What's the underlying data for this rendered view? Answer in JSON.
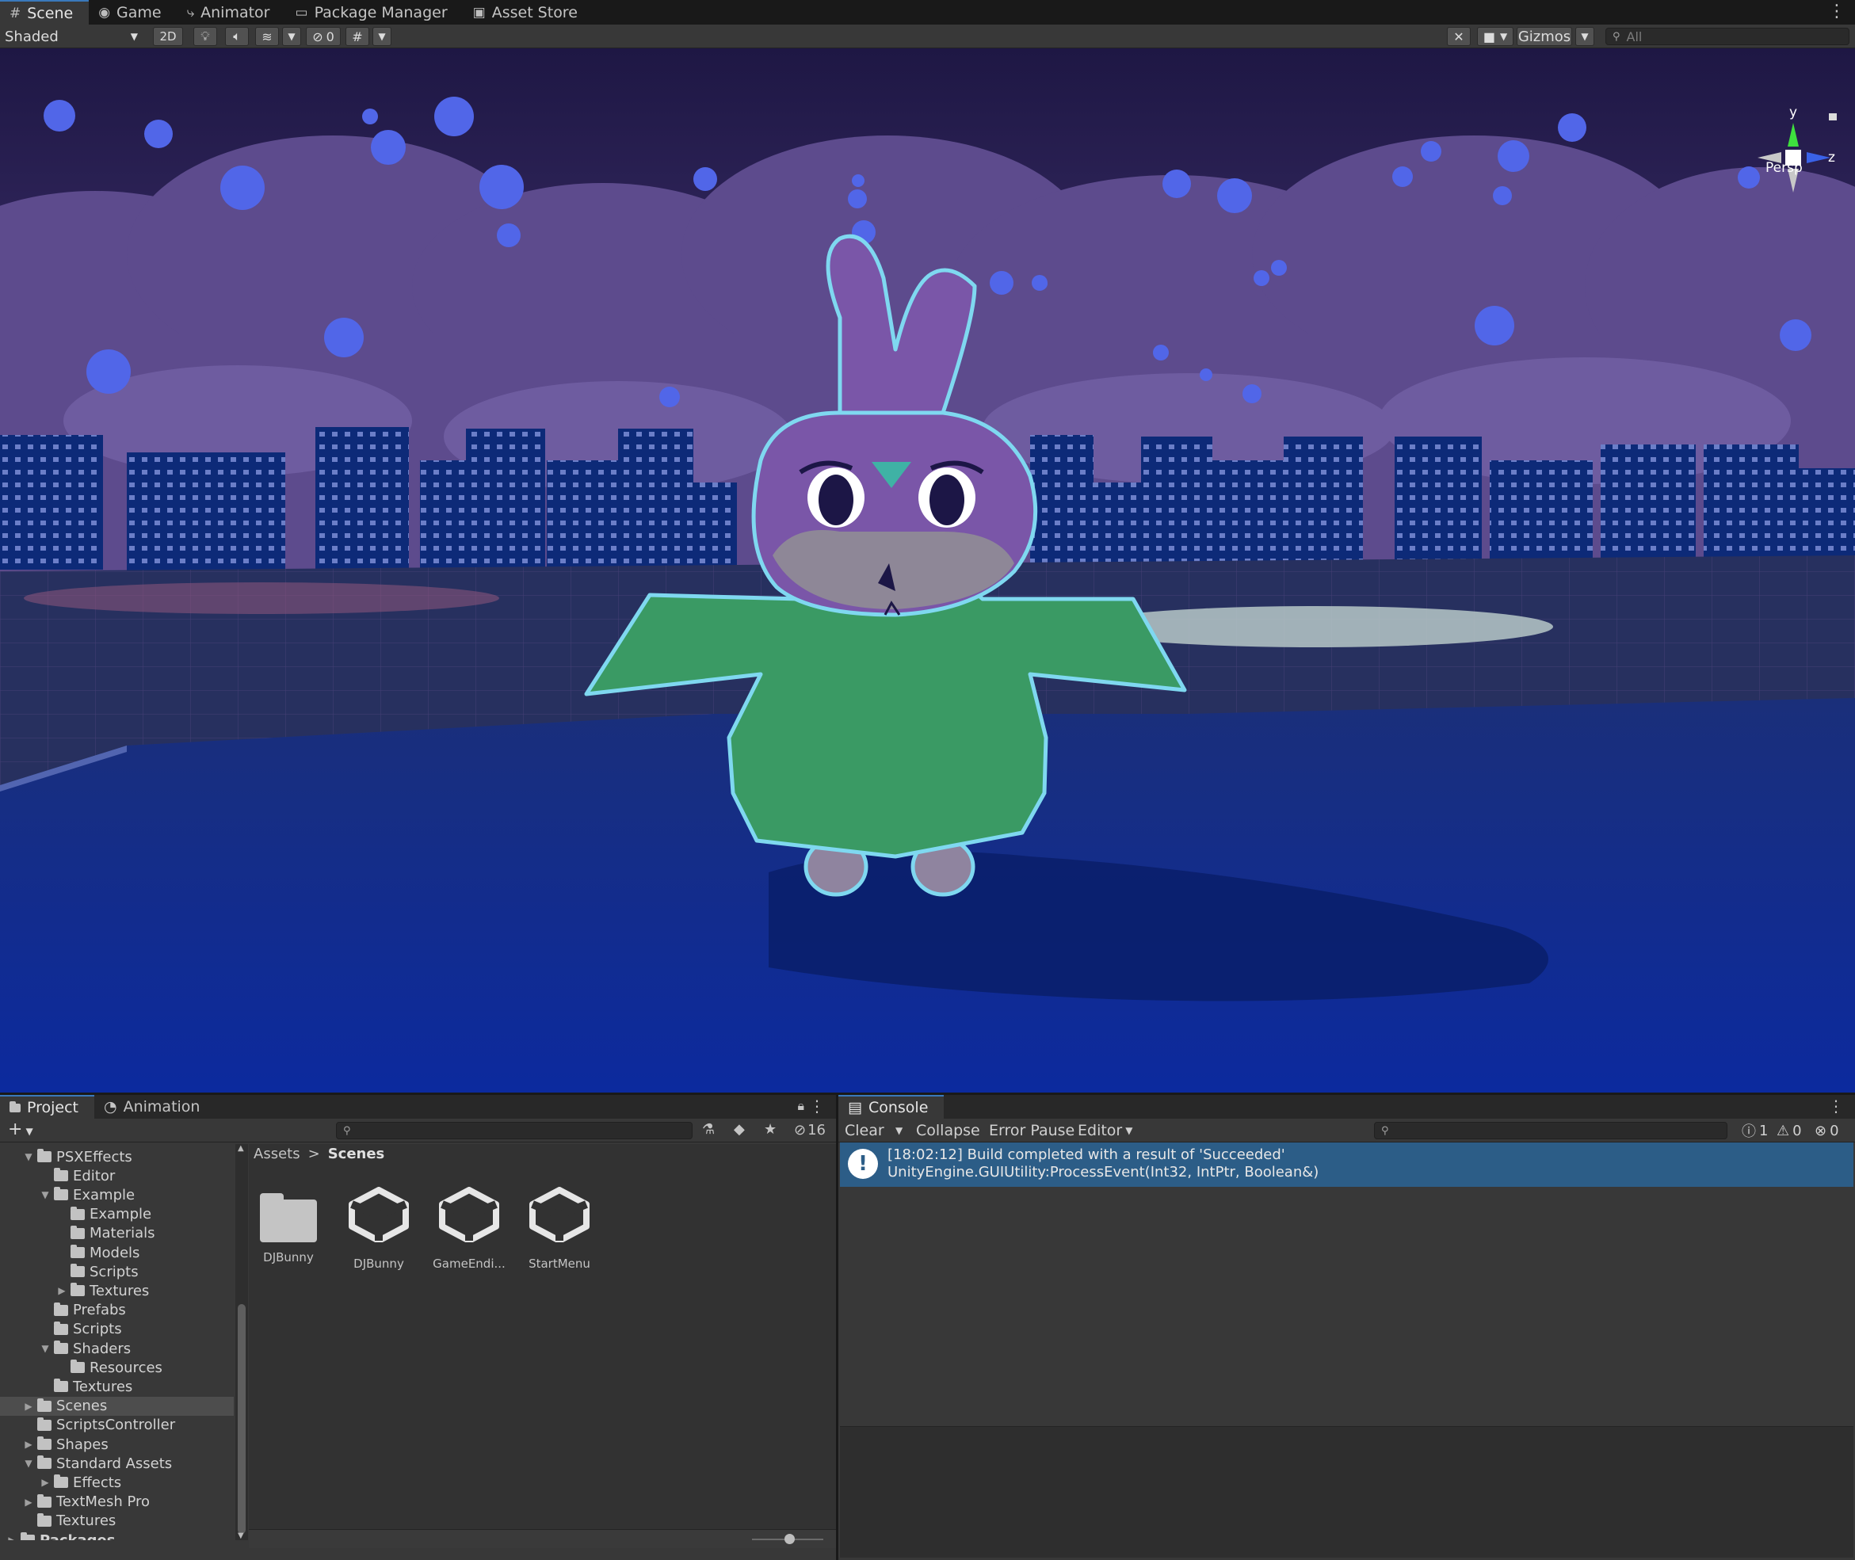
{
  "top_tabs": [
    {
      "label": "Scene",
      "icon": "grid-icon",
      "active": true
    },
    {
      "label": "Game",
      "icon": "gamepad-icon",
      "active": false
    },
    {
      "label": "Animator",
      "icon": "animator-icon",
      "active": false
    },
    {
      "label": "Package Manager",
      "icon": "package-icon",
      "active": false
    },
    {
      "label": "Asset Store",
      "icon": "store-icon",
      "active": false
    }
  ],
  "scene_toolbar": {
    "shading_mode": "Shaded",
    "mode_2d": "2D",
    "hidden_count": "0",
    "gizmos": "Gizmos",
    "search_placeholder": "All"
  },
  "gizmo": {
    "y_label": "y",
    "z_label": "z",
    "projection": "Persp"
  },
  "project_panel": {
    "tabs": [
      {
        "label": "Project",
        "icon": "folder-icon",
        "active": true
      },
      {
        "label": "Animation",
        "icon": "clock-icon",
        "active": false
      }
    ],
    "visible_count": "16",
    "tree": [
      {
        "label": "PSXEffects",
        "depth": 1,
        "arrow": "expanded"
      },
      {
        "label": "Editor",
        "depth": 2,
        "arrow": "none"
      },
      {
        "label": "Example",
        "depth": 2,
        "arrow": "expanded"
      },
      {
        "label": "Example",
        "depth": 3,
        "arrow": "none"
      },
      {
        "label": "Materials",
        "depth": 3,
        "arrow": "none"
      },
      {
        "label": "Models",
        "depth": 3,
        "arrow": "none"
      },
      {
        "label": "Scripts",
        "depth": 3,
        "arrow": "none"
      },
      {
        "label": "Textures",
        "depth": 3,
        "arrow": "collapsed"
      },
      {
        "label": "Prefabs",
        "depth": 2,
        "arrow": "none"
      },
      {
        "label": "Scripts",
        "depth": 2,
        "arrow": "none"
      },
      {
        "label": "Shaders",
        "depth": 2,
        "arrow": "expanded"
      },
      {
        "label": "Resources",
        "depth": 3,
        "arrow": "none"
      },
      {
        "label": "Textures",
        "depth": 2,
        "arrow": "none"
      },
      {
        "label": "Scenes",
        "depth": 1,
        "arrow": "collapsed",
        "selected": true
      },
      {
        "label": "ScriptsController",
        "depth": 1,
        "arrow": "none"
      },
      {
        "label": "Shapes",
        "depth": 1,
        "arrow": "collapsed"
      },
      {
        "label": "Standard Assets",
        "depth": 1,
        "arrow": "expanded"
      },
      {
        "label": "Effects",
        "depth": 2,
        "arrow": "collapsed"
      },
      {
        "label": "TextMesh Pro",
        "depth": 1,
        "arrow": "collapsed"
      },
      {
        "label": "Textures",
        "depth": 1,
        "arrow": "none"
      },
      {
        "label": "Packages",
        "depth": 0,
        "arrow": "collapsed",
        "bold": true
      }
    ],
    "breadcrumb": {
      "root": "Assets",
      "separator": ">",
      "current": "Scenes"
    },
    "assets": [
      {
        "label": "DJBunny",
        "icon": "folder-icon"
      },
      {
        "label": "DJBunny",
        "icon": "unity-scene-icon"
      },
      {
        "label": "GameEndi...",
        "icon": "unity-scene-icon"
      },
      {
        "label": "StartMenu",
        "icon": "unity-scene-icon"
      }
    ]
  },
  "console_panel": {
    "tab_label": "Console",
    "buttons": {
      "clear": "Clear",
      "collapse": "Collapse",
      "error_pause": "Error Pause",
      "editor": "Editor"
    },
    "counts": {
      "info": "1",
      "warnings": "0",
      "errors": "0"
    },
    "log": {
      "line1": "[18:02:12] Build completed with a result of 'Succeeded'",
      "line2": "UnityEngine.GUIUtility:ProcessEvent(Int32, IntPtr, Boolean&)"
    }
  },
  "colors": {
    "accent": "#3a79bb",
    "log_highlight": "#2c5d87",
    "sky": "#3b2d6a",
    "ground": "#0e30a8",
    "bunny_body": "#3a9a64",
    "bunny_head": "#7a56a8",
    "outline": "#7fd8f0"
  }
}
